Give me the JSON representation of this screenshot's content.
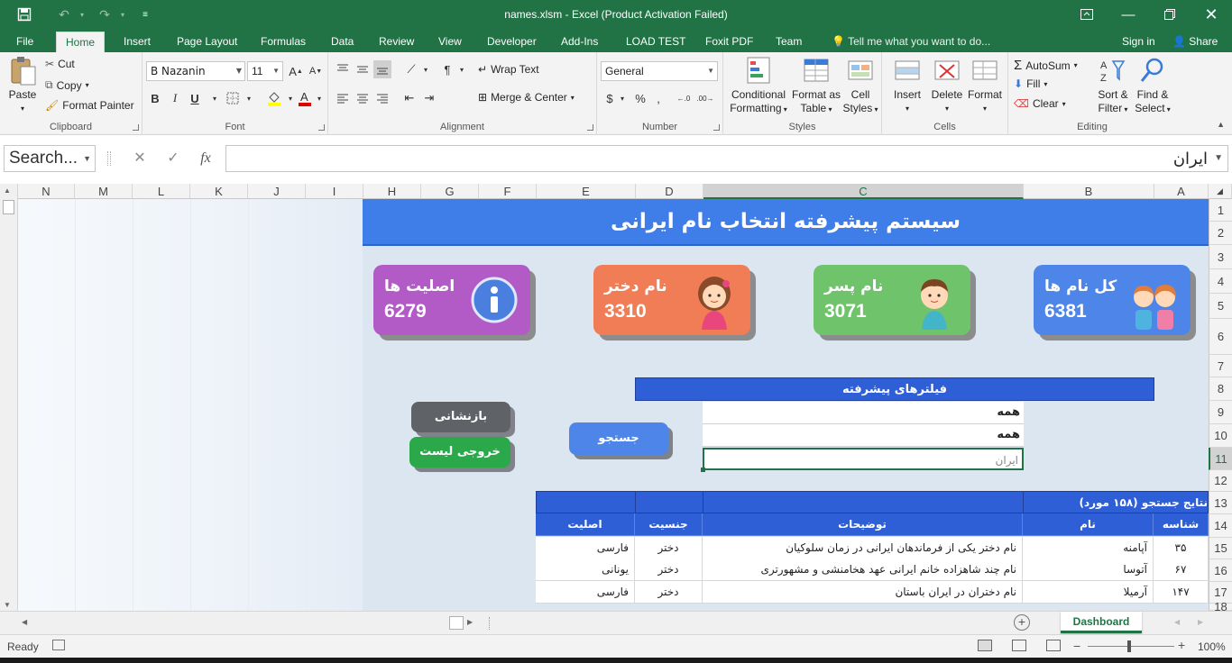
{
  "window": {
    "title": "names.xlsm - Excel (Product Activation Failed)"
  },
  "ribbon_tabs": [
    "File",
    "Home",
    "Insert",
    "Page Layout",
    "Formulas",
    "Data",
    "Review",
    "View",
    "Developer",
    "Add-Ins",
    "LOAD TEST",
    "Foxit PDF",
    "Team"
  ],
  "tell_me": "Tell me what you want to do...",
  "account": {
    "sign_in": "Sign in",
    "share": "Share"
  },
  "clipboard": {
    "paste": "Paste",
    "cut": "Cut",
    "copy": "Copy",
    "format_painter": "Format Painter",
    "label": "Clipboard"
  },
  "font": {
    "name": "B Nazanin",
    "size": "11",
    "bold": "B",
    "italic": "I",
    "underline": "U",
    "label": "Font"
  },
  "alignment": {
    "wrap_text": "Wrap Text",
    "merge_center": "Merge & Center",
    "label": "Alignment"
  },
  "number": {
    "format": "General",
    "label": "Number"
  },
  "styles": {
    "conditional": "Conditional",
    "conditional2": "Formatting",
    "format_as": "Format as",
    "format_as2": "Table",
    "cell": "Cell",
    "cell2": "Styles",
    "label": "Styles"
  },
  "cells": {
    "insert": "Insert",
    "delete": "Delete",
    "format": "Format",
    "label": "Cells"
  },
  "editing": {
    "autosum": "AutoSum",
    "fill": "Fill",
    "clear": "Clear",
    "sort": "Sort &",
    "sort2": "Filter",
    "find": "Find &",
    "find2": "Select",
    "label": "Editing"
  },
  "formula_bar": {
    "name_box": "Search...",
    "value": "ایران",
    "fx": "fx"
  },
  "columns": [
    "N",
    "M",
    "L",
    "K",
    "J",
    "I",
    "H",
    "G",
    "F",
    "E",
    "D",
    "C",
    "B",
    "A"
  ],
  "rows": [
    "1",
    "2",
    "3",
    "4",
    "5",
    "6",
    "7",
    "8",
    "9",
    "10",
    "11",
    "12",
    "13",
    "14",
    "15",
    "16",
    "17",
    "18"
  ],
  "dashboard": {
    "title": "سیستم پیشرفته انتخاب نام ایرانی",
    "cards": [
      {
        "title": "اصلیت ها",
        "value": "6279",
        "color": "#b25bc6"
      },
      {
        "title": "نام دختر",
        "value": "3310",
        "color": "#f07d55"
      },
      {
        "title": "نام پسر",
        "value": "3071",
        "color": "#6fc36b"
      },
      {
        "title": "کل نام ها",
        "value": "6381",
        "color": "#4d86e8"
      }
    ],
    "filters_title": "فیلترهای پیشرفته",
    "filter_values": [
      "همه",
      "همه",
      "ایران"
    ],
    "buttons": {
      "reset": "بازنشانی",
      "export": "خروجی لیست",
      "search": "جستجو"
    },
    "results_title": "نتایج جستجو (۱۵۸ مورد)",
    "table_headers": {
      "id": "شناسه",
      "name": "نام",
      "desc": "توضیحات",
      "gender": "جنسیت",
      "origin": "اصلیت"
    },
    "table_rows": [
      {
        "id": "۳۵",
        "name": "آپامنه",
        "desc": "نام دختر یکی از فرماندهان ایرانی در زمان سلوکیان",
        "gender": "دختر",
        "origin": "فارسی"
      },
      {
        "id": "۶۷",
        "name": "آتوسا",
        "desc": "نام چند شاهزاده خانم ایرانی عهد هخامنشی و مشهورتری",
        "gender": "دختر",
        "origin": "یونانی"
      },
      {
        "id": "۱۴۷",
        "name": "آرمیلا",
        "desc": "نام دختران در ایران باستان",
        "gender": "دختر",
        "origin": "فارسی"
      }
    ]
  },
  "sheet_tab": "Dashboard",
  "status": {
    "ready": "Ready",
    "zoom": "100%"
  }
}
